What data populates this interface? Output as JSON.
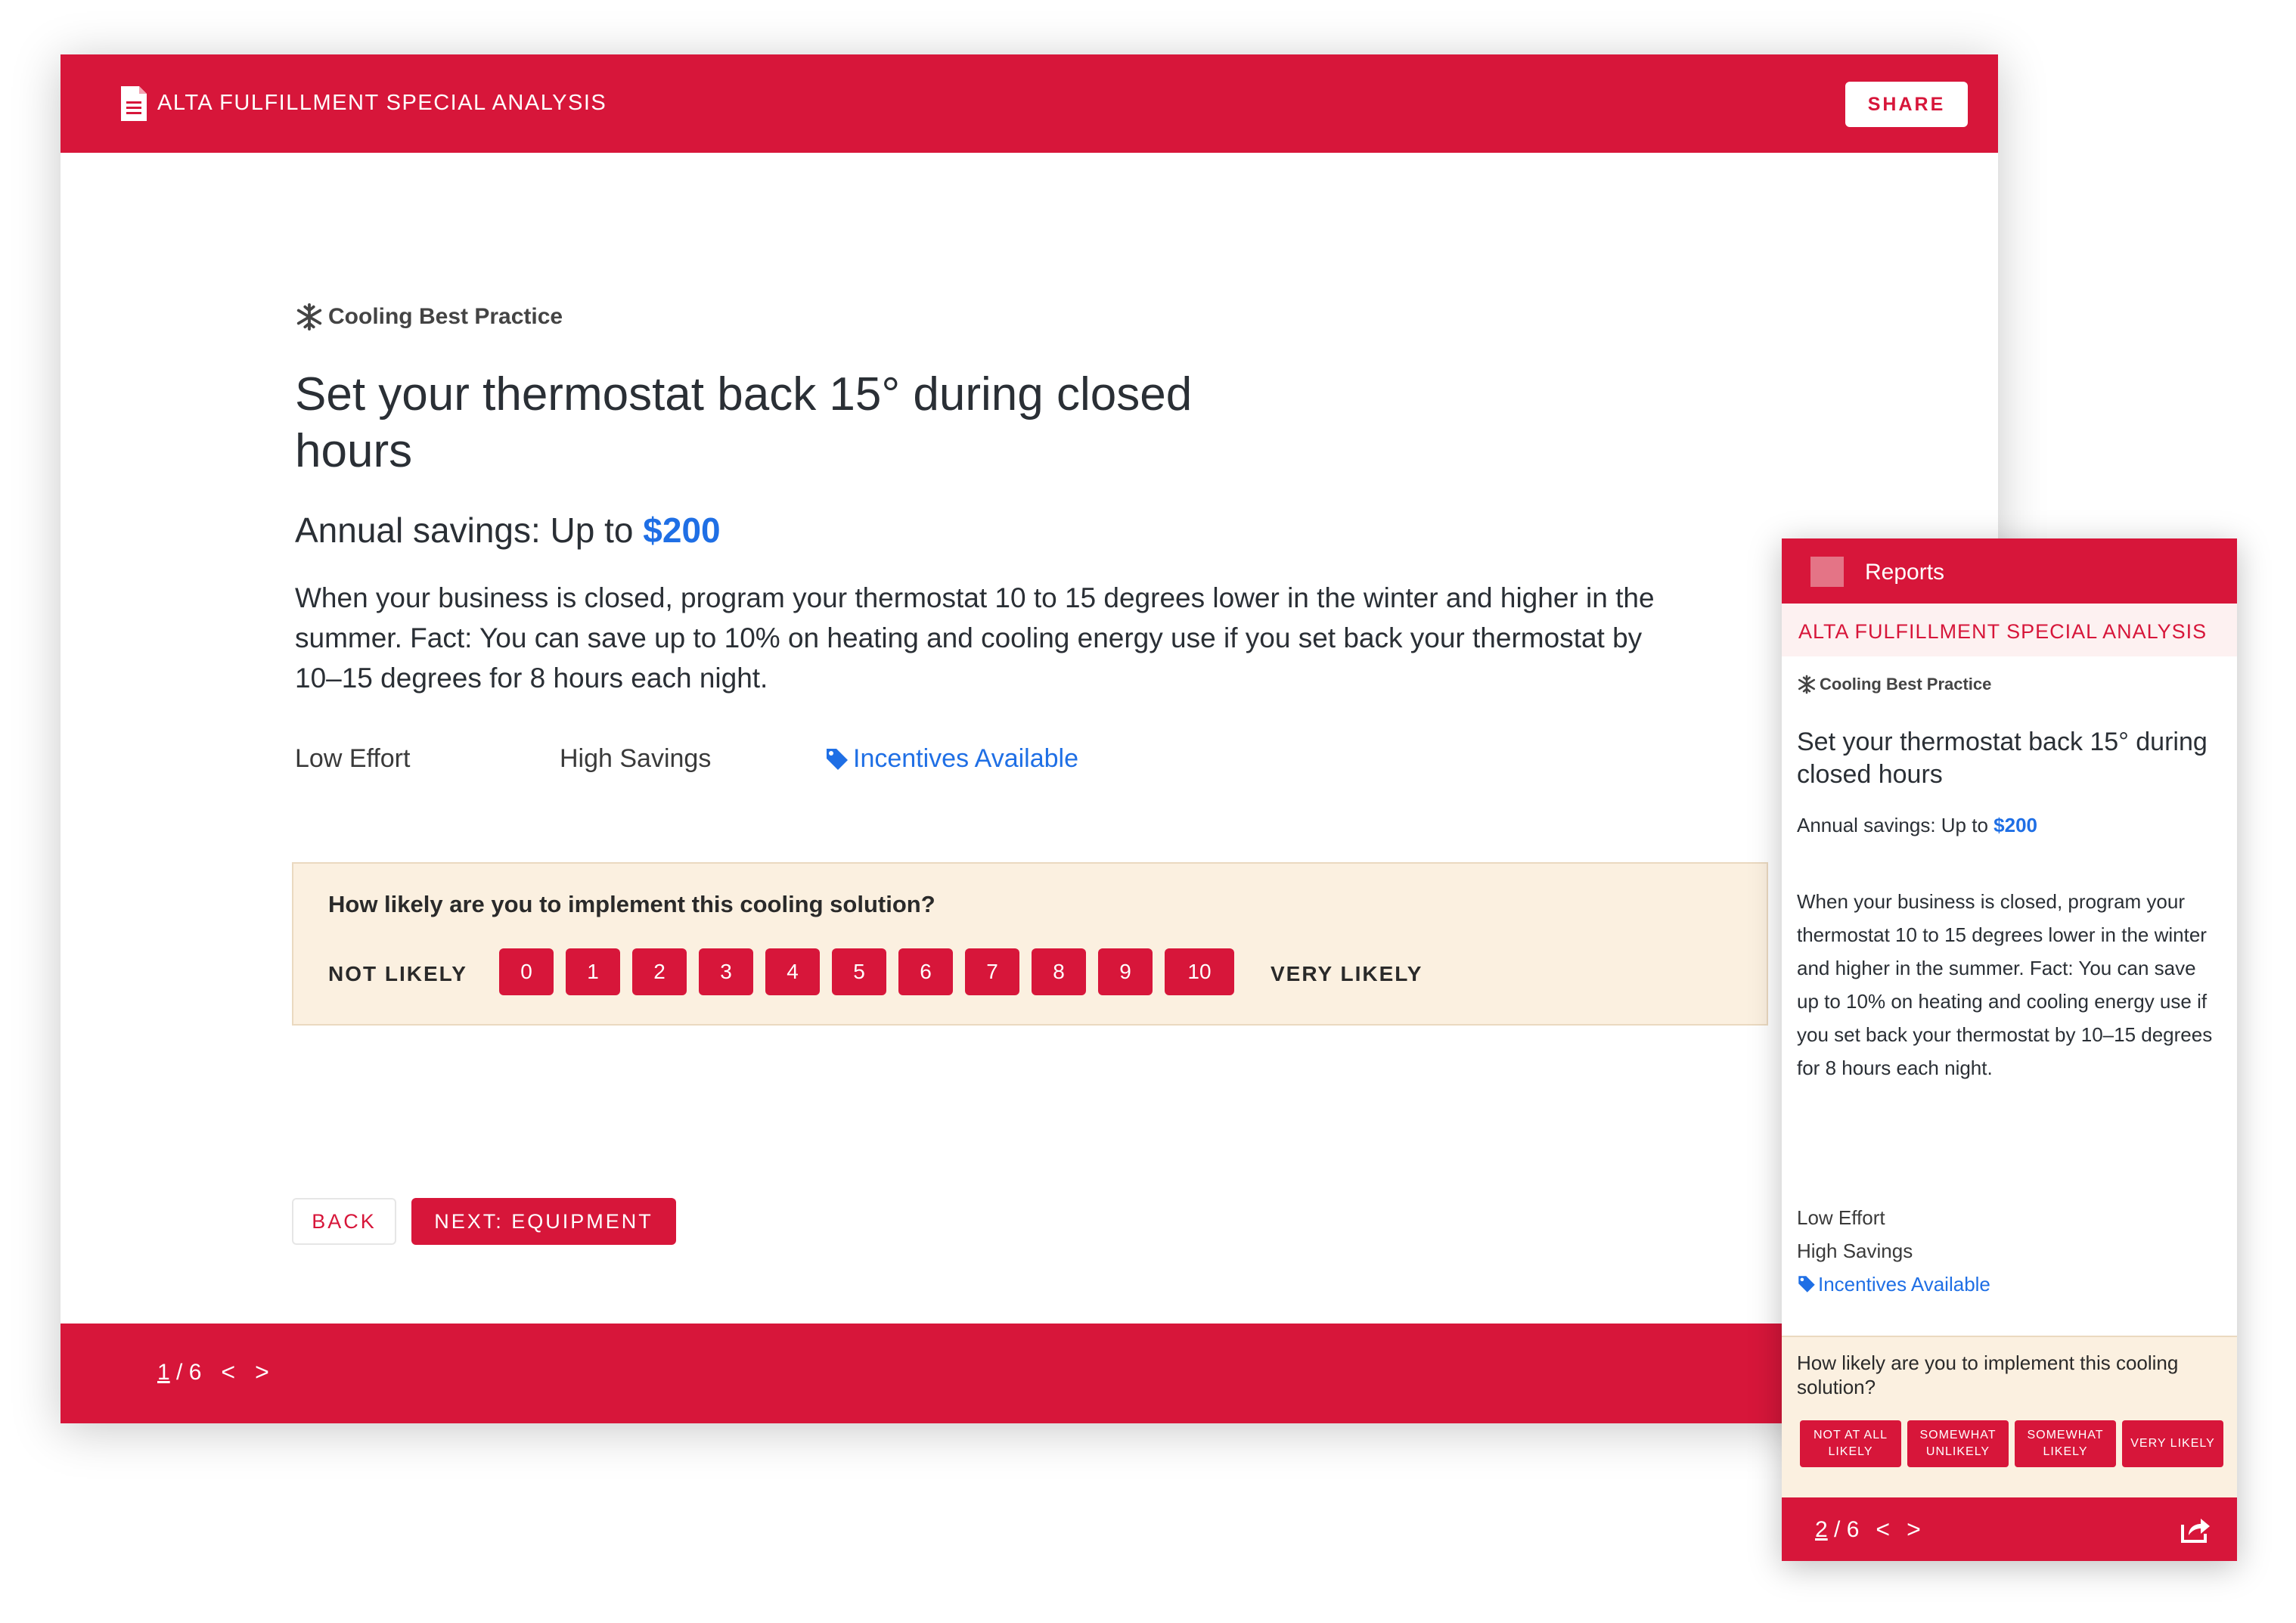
{
  "desktop": {
    "header": {
      "title": "ALTA FULFILLMENT SPECIAL ANALYSIS",
      "share_label": "SHARE"
    },
    "category": "Cooling Best Practice",
    "title": "Set your thermostat back 15° during closed hours",
    "savings": {
      "prefix": "Annual savings: Up to ",
      "amount": "$200"
    },
    "description": "When your business is closed, program your thermostat 10 to 15 degrees lower in the winter and higher in the summer. Fact: You can save up to 10% on heating and cooling energy use if you set back your thermostat by 10–15 degrees for 8 hours each night.",
    "tags": {
      "effort": "Low Effort",
      "savings": "High Savings",
      "incentives": "Incentives Available"
    },
    "survey": {
      "question": "How likely are you to implement this cooling solution?",
      "low_label": "NOT LIKELY",
      "high_label": "VERY LIKELY",
      "scale": [
        "0",
        "1",
        "2",
        "3",
        "4",
        "5",
        "6",
        "7",
        "8",
        "9",
        "10"
      ]
    },
    "buttons": {
      "back": "BACK",
      "next": "NEXT: EQUIPMENT"
    },
    "pager": {
      "current": "1",
      "separator": " / ",
      "total": "6",
      "prev": "<",
      "next": ">"
    }
  },
  "mobile": {
    "header": {
      "label": "Reports"
    },
    "subtitle": "ALTA FULFILLMENT SPECIAL ANALYSIS",
    "category": "Cooling Best Practice",
    "title": "Set your thermostat back 15° during closed hours",
    "savings": {
      "prefix": "Annual savings: Up to ",
      "amount": "$200"
    },
    "description": "When your business is closed, program your thermostat 10 to 15 degrees lower in the winter and higher in the summer. Fact: You can save up to 10% on heating and cooling energy use if you set back your thermostat by 10–15 degrees for 8 hours each night.",
    "tags": {
      "effort": "Low Effort",
      "savings": "High Savings",
      "incentives": "Incentives Available"
    },
    "survey": {
      "question": "How likely are you to implement this cooling solution?",
      "options": [
        "NOT AT ALL LIKELY",
        "SOMEWHAT UNLIKELY",
        "SOMEWHAT LIKELY",
        "VERY LIKELY"
      ]
    },
    "pager": {
      "current": "2",
      "separator": " / ",
      "total": "6",
      "prev": "<",
      "next": ">"
    }
  },
  "colors": {
    "brand": "#d7163a",
    "accent": "#1f6fe5",
    "survey_bg": "#fbf0e0"
  },
  "icons": [
    "document-icon",
    "snowflake-icon",
    "tag-icon",
    "hamburger-menu-icon",
    "share-icon"
  ]
}
